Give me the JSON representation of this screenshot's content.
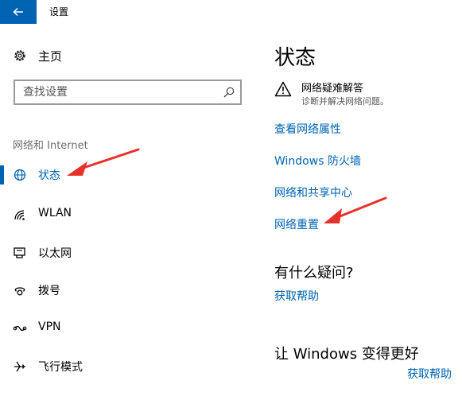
{
  "window": {
    "title": "设置"
  },
  "sidebar": {
    "home_label": "主页",
    "search_placeholder": "查找设置",
    "section_label": "网络和 Internet",
    "items": [
      {
        "label": "状态",
        "icon": "globe-icon",
        "active": true
      },
      {
        "label": "WLAN",
        "icon": "wifi-icon",
        "active": false
      },
      {
        "label": "以太网",
        "icon": "ethernet-icon",
        "active": false
      },
      {
        "label": "拨号",
        "icon": "dialup-icon",
        "active": false
      },
      {
        "label": "VPN",
        "icon": "vpn-icon",
        "active": false
      },
      {
        "label": "飞行模式",
        "icon": "airplane-icon",
        "active": false
      }
    ]
  },
  "main": {
    "title": "状态",
    "troubleshooter": {
      "title": "网络疑难解答",
      "subtitle": "诊断并解决网络问题。"
    },
    "links": [
      "查看网络属性",
      "Windows 防火墙",
      "网络和共享中心",
      "网络重置"
    ],
    "questions": {
      "heading": "有什么疑问?",
      "link": "获取帮助"
    },
    "feedback": {
      "heading": "让 Windows 变得更好",
      "link": "获取帮助"
    }
  },
  "colors": {
    "accent": "#0063b1",
    "annotation_arrow": "#e8312a"
  }
}
